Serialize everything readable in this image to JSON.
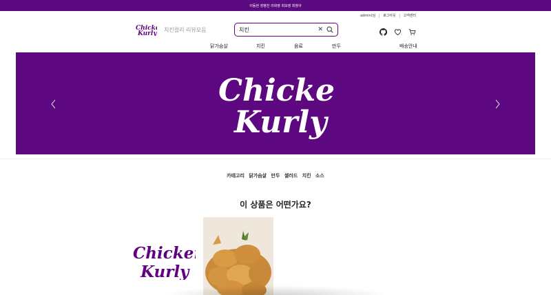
{
  "top_banner": {
    "text": "이동현 장병진 라화영 최보영 최창아"
  },
  "util": {
    "user": "admin(님",
    "logout": "로그아웃",
    "support": "고객센터"
  },
  "header": {
    "logo_alt": "Chicken Kurly",
    "links": [
      "치킨컬리",
      "리뷰모음"
    ]
  },
  "search": {
    "value": "치킨",
    "placeholder": ""
  },
  "icons": [
    "github-icon",
    "heart-icon",
    "cart-icon"
  ],
  "gnb": [
    "닭가슴살",
    "치킨",
    "음료",
    "만두",
    "배송안내"
  ],
  "hero": {
    "logo_text": "Chicken Kurly"
  },
  "categories": [
    "카테고리",
    "닭가슴살",
    "만두",
    "샐러드",
    "치킨",
    "소스"
  ],
  "section": {
    "title": "이 상품은 어떤가요?"
  },
  "colors": {
    "brand": "#5f0080",
    "banner": "#5b0a82"
  }
}
